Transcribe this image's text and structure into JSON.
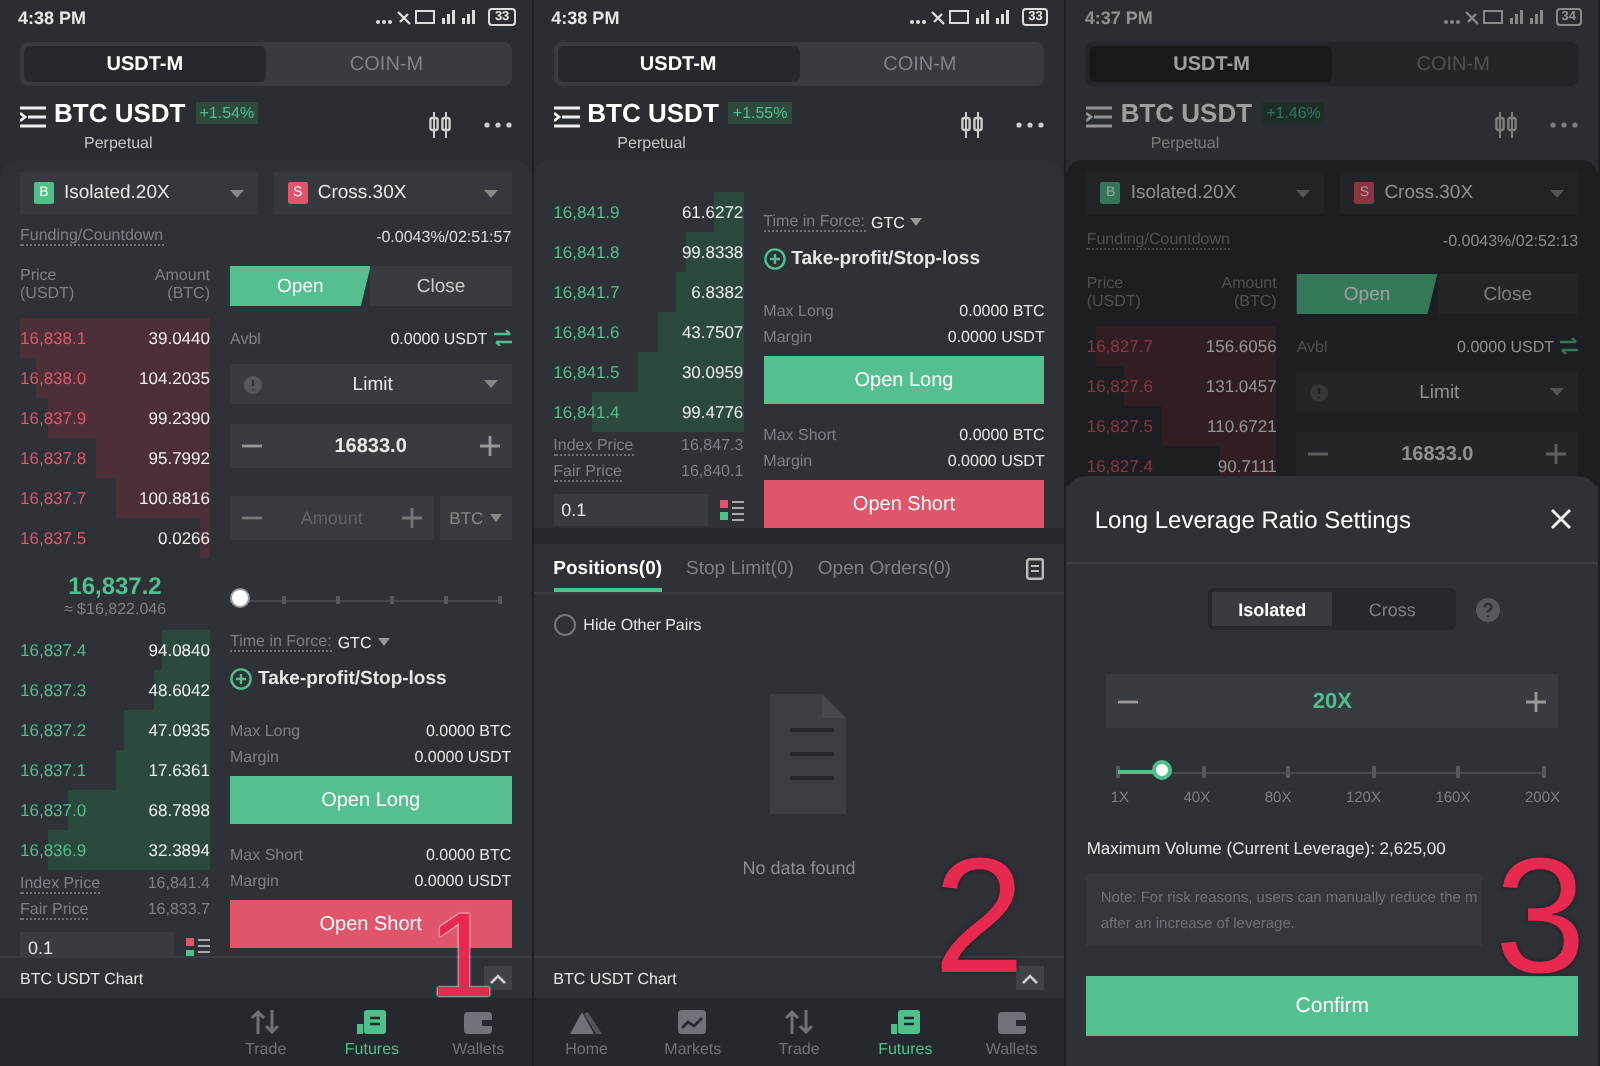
{
  "screens": [
    {
      "kind": "trade",
      "annotation": "1",
      "status_bar": {
        "time": "4:38 PM",
        "battery": "33"
      },
      "market_tabs": [
        {
          "label": "USDT-M",
          "selected": true
        },
        {
          "label": "COIN-M",
          "selected": false
        }
      ],
      "header": {
        "pair": "BTC USDT",
        "change": "+1.54%",
        "subtitle": "Perpetual"
      },
      "margin_modes": [
        {
          "kind": "buy",
          "badge": "B",
          "label": "Isolated.20X"
        },
        {
          "kind": "sell",
          "badge": "S",
          "label": "Cross.30X"
        }
      ],
      "funding": {
        "label": "Funding/Countdown",
        "value": "-0.0043%/02:51:57"
      },
      "order_book": {
        "price_header": "Price (USDT)",
        "amount_header": "Amount (BTC)",
        "asks": [
          {
            "price": "16,838.1",
            "amount": "39.0440",
            "level": 1
          },
          {
            "price": "16,838.0",
            "amount": "104.2035",
            "level": 0.92
          },
          {
            "price": "16,837.9",
            "amount": "99.2390",
            "level": 0.85
          },
          {
            "price": "16,837.8",
            "amount": "95.7992",
            "level": 0.6
          },
          {
            "price": "16,837.7",
            "amount": "100.8816",
            "level": 0.5
          },
          {
            "price": "16,837.5",
            "amount": "0.0266",
            "level": 0.05
          }
        ],
        "last_price": "16,837.2",
        "last_price_usd": "≈ $16,822.046",
        "bids": [
          {
            "price": "16,837.4",
            "amount": "94.0840",
            "level": 0.25
          },
          {
            "price": "16,837.3",
            "amount": "48.6042",
            "level": 0.3
          },
          {
            "price": "16,837.2",
            "amount": "47.0935",
            "level": 0.45
          },
          {
            "price": "16,837.1",
            "amount": "17.6361",
            "level": 0.5
          },
          {
            "price": "16,837.0",
            "amount": "68.7898",
            "level": 0.75
          },
          {
            "price": "16,836.9",
            "amount": "32.3894",
            "level": 0.85
          }
        ],
        "index_price": {
          "label": "Index Price",
          "value": "16,841.4"
        },
        "fair_price": {
          "label": "Fair Price",
          "value": "16,833.7"
        },
        "depth": "0.1"
      },
      "order_form": {
        "actions": [
          {
            "label": "Open",
            "selected": true
          },
          {
            "label": "Close",
            "selected": false
          }
        ],
        "available": {
          "label": "Avbl",
          "value": "0.0000 USDT"
        },
        "order_type": "Limit",
        "price": "16833.0",
        "amount_placeholder": "Amount",
        "unit": "BTC",
        "slider": {
          "level": 0
        },
        "time_in_force": {
          "label": "Time in Force:",
          "value": "GTC"
        },
        "tpsl": "Take-profit/Stop-loss",
        "long": {
          "rows": [
            {
              "label": "Max Long",
              "value": "0.0000 BTC"
            },
            {
              "label": "Margin",
              "value": "0.0000 USDT"
            }
          ],
          "button": "Open Long"
        },
        "short": {
          "rows": [
            {
              "label": "Max Short",
              "value": "0.0000 BTC"
            },
            {
              "label": "Margin",
              "value": "0.0000 USDT"
            }
          ],
          "button": "Open Short"
        }
      },
      "chart_bar": {
        "label": "BTC USDT Chart"
      },
      "nav": [
        {
          "kind": "trade",
          "label": "Trade",
          "selected": false
        },
        {
          "kind": "futures",
          "label": "Futures",
          "selected": true
        },
        {
          "kind": "wallets",
          "label": "Wallets",
          "selected": false
        }
      ]
    },
    {
      "kind": "positions",
      "annotation": "2",
      "status_bar": {
        "time": "4:38 PM",
        "battery": "33"
      },
      "market_tabs": [
        {
          "label": "USDT-M",
          "selected": true
        },
        {
          "label": "COIN-M",
          "selected": false
        }
      ],
      "header": {
        "pair": "BTC USDT",
        "change": "+1.55%",
        "subtitle": "Perpetual"
      },
      "order_book": {
        "bids": [
          {
            "price": "16,841.9",
            "amount": "61.6272",
            "level": 0.15
          },
          {
            "price": "16,841.8",
            "amount": "99.8338",
            "level": 0.3
          },
          {
            "price": "16,841.7",
            "amount": "6.8382",
            "level": 0.35
          },
          {
            "price": "16,841.6",
            "amount": "43.7507",
            "level": 0.45
          },
          {
            "price": "16,841.5",
            "amount": "30.0959",
            "level": 0.55
          },
          {
            "price": "16,841.4",
            "amount": "99.4776",
            "level": 0.8
          }
        ],
        "index_price": {
          "label": "Index Price",
          "value": "16,847.3"
        },
        "fair_price": {
          "label": "Fair Price",
          "value": "16,840.1"
        },
        "depth": "0.1"
      },
      "order_form": {
        "time_in_force": {
          "label": "Time in Force:",
          "value": "GTC"
        },
        "tpsl": "Take-profit/Stop-loss",
        "long": {
          "rows": [
            {
              "label": "Max Long",
              "value": "0.0000 BTC"
            },
            {
              "label": "Margin",
              "value": "0.0000 USDT"
            }
          ],
          "button": "Open Long"
        },
        "short": {
          "rows": [
            {
              "label": "Max Short",
              "value": "0.0000 BTC"
            },
            {
              "label": "Margin",
              "value": "0.0000 USDT"
            }
          ],
          "button": "Open Short"
        }
      },
      "positions": {
        "tabs": [
          {
            "label": "Positions(0)",
            "selected": true
          },
          {
            "label": "Stop Limit(0)",
            "selected": false
          },
          {
            "label": "Open Orders(0)",
            "selected": false
          }
        ],
        "hide_other_pairs": {
          "label": "Hide Other Pairs",
          "checked": false
        },
        "empty": "No data found"
      },
      "chart_bar": {
        "label": "BTC USDT Chart"
      },
      "nav": [
        {
          "kind": "home",
          "label": "Home",
          "selected": false
        },
        {
          "kind": "markets",
          "label": "Markets",
          "selected": false
        },
        {
          "kind": "trade",
          "label": "Trade",
          "selected": false
        },
        {
          "kind": "futures",
          "label": "Futures",
          "selected": true
        },
        {
          "kind": "wallets",
          "label": "Wallets",
          "selected": false
        }
      ]
    },
    {
      "kind": "leverage",
      "annotation": "3",
      "status_bar": {
        "time": "4:37 PM",
        "battery": "34"
      },
      "market_tabs": [
        {
          "label": "USDT-M",
          "selected": true
        },
        {
          "label": "COIN-M",
          "selected": false
        }
      ],
      "header": {
        "pair": "BTC USDT",
        "change": "+1.46%",
        "subtitle": "Perpetual"
      },
      "margin_modes": [
        {
          "kind": "buy",
          "badge": "B",
          "label": "Isolated.20X"
        },
        {
          "kind": "sell",
          "badge": "S",
          "label": "Cross.30X"
        }
      ],
      "funding": {
        "label": "Funding/Countdown",
        "value": "-0.0043%/02:52:13"
      },
      "order_book": {
        "price_header": "Price (USDT)",
        "amount_header": "Amount (BTC)",
        "asks": [
          {
            "price": "16,827.7",
            "amount": "156.6056",
            "level": 0.95
          },
          {
            "price": "16,827.6",
            "amount": "131.0457",
            "level": 0.8
          },
          {
            "price": "16,827.5",
            "amount": "110.6721",
            "level": 0.6
          },
          {
            "price": "16,827.4",
            "amount": "90.7111",
            "level": 0.3
          }
        ]
      },
      "order_form": {
        "actions": [
          {
            "label": "Open",
            "selected": true
          },
          {
            "label": "Close",
            "selected": false
          }
        ],
        "available": {
          "label": "Avbl",
          "value": "0.0000 USDT"
        },
        "order_type": "Limit",
        "price": "16833.0"
      },
      "sheet": {
        "title": "Long Leverage Ratio Settings",
        "modes": [
          {
            "label": "Isolated",
            "selected": true
          },
          {
            "label": "Cross",
            "selected": false
          }
        ],
        "leverage": "20X",
        "slider": {
          "level": 0.1
        },
        "ticks": [
          "1X",
          "40X",
          "80X",
          "120X",
          "160X",
          "200X"
        ],
        "max_volume": "Maximum Volume (Current Leverage): 2,625,00",
        "note_lines": [
          "Note: For risk reasons, users can manually reduce the m",
          "after an increase of leverage."
        ],
        "confirm": "Confirm"
      }
    }
  ]
}
